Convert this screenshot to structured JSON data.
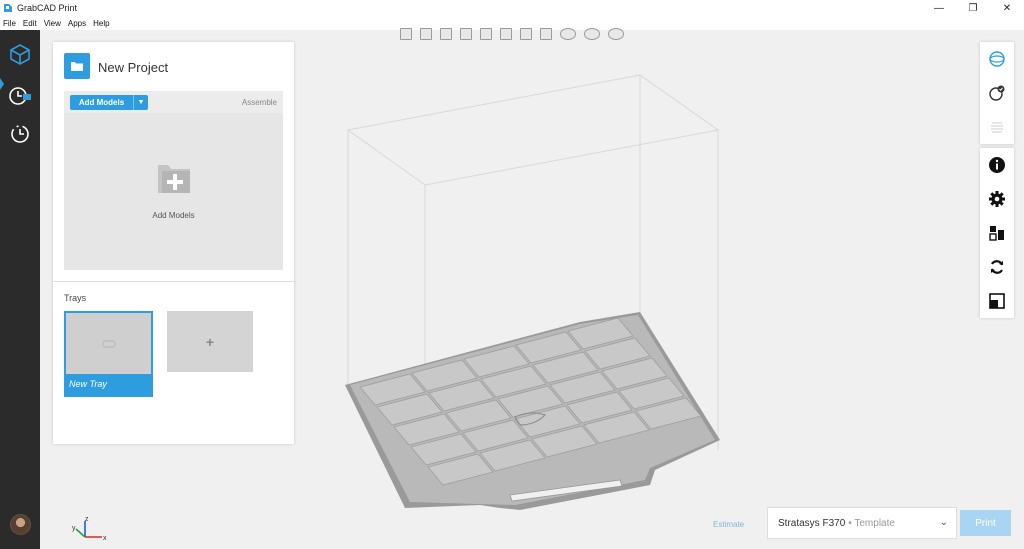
{
  "window": {
    "title": "GrabCAD Print",
    "controls": {
      "minimize": "—",
      "maximize": "❐",
      "close": "✕"
    }
  },
  "menu": [
    "File",
    "Edit",
    "View",
    "Apps",
    "Help"
  ],
  "sidebar": {
    "items": [
      "models-cube",
      "print-queue-clock",
      "history-clock"
    ],
    "accent": "#2d9de0"
  },
  "project": {
    "title": "New Project",
    "add_models_button": "Add Models",
    "assemble_label": "Assemble",
    "add_models_placeholder": "Add Models",
    "trays_heading": "Trays",
    "trays": [
      {
        "label": "New Tray",
        "selected": true
      }
    ],
    "add_tray_symbol": "+"
  },
  "view_toolbar": [
    "view-cube-icon",
    "view-front-icon",
    "view-back-icon",
    "view-left-icon",
    "view-right-icon",
    "view-top-icon",
    "view-iso-icon",
    "view-perspective-icon",
    "view-group-a-icon",
    "view-group-b-icon",
    "view-group-c-icon"
  ],
  "right_toolbar": {
    "top_group": [
      "globe-icon",
      "estimate-icon",
      "slice-icon"
    ],
    "bottom_group": [
      "info-icon",
      "settings-icon",
      "arrange-icon",
      "rotate-icon",
      "scale-icon"
    ]
  },
  "bottom": {
    "estimate_label": "Estimate",
    "printer_name": "Stratasys F370",
    "printer_template": "• Template",
    "print_button": "Print"
  },
  "axes": {
    "x": "x",
    "y": "y",
    "z": "z"
  },
  "colors": {
    "accent": "#2d9de0",
    "print_disabled": "#a9d4f2",
    "sidebar_bg": "#2b2b2b",
    "viewport_bg": "#f0f0f0"
  }
}
